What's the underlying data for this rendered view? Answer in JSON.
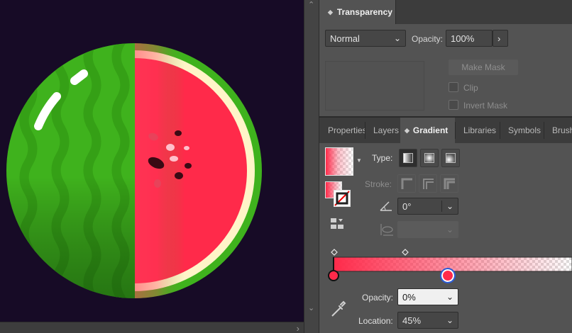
{
  "transparency": {
    "title": "Transparency",
    "blend_mode": "Normal",
    "opacity_label": "Opacity:",
    "opacity_value": "100%",
    "make_mask_label": "Make Mask",
    "clip_label": "Clip",
    "invert_mask_label": "Invert Mask"
  },
  "tabs": [
    {
      "label": "Properties"
    },
    {
      "label": "Layers"
    },
    {
      "label": "Gradient"
    },
    {
      "label": "Libraries"
    },
    {
      "label": "Symbols"
    },
    {
      "label": "Brushes"
    }
  ],
  "gradient": {
    "type_label": "Type:",
    "stroke_label": "Stroke:",
    "angle_value": "0°",
    "slider_color_left": "#ff2a4a",
    "stop_opacity_label": "Opacity:",
    "stop_opacity_value": "0%",
    "location_label": "Location:",
    "location_value": "45%"
  },
  "colors": {
    "canvas_bg": "#170b26",
    "rind_green": "#3fb21d",
    "flesh_red": "#ff2a4a",
    "seed_dark": "#3a0a14",
    "seed_light": "#ffc0cb",
    "rind_highlight": "#fff4c8"
  },
  "icons": {
    "opacity_expand": "chevron-right-icon",
    "angle": "angle-icon",
    "aspect": "aspect-ratio-icon",
    "eyedropper": "eyedropper-icon"
  }
}
